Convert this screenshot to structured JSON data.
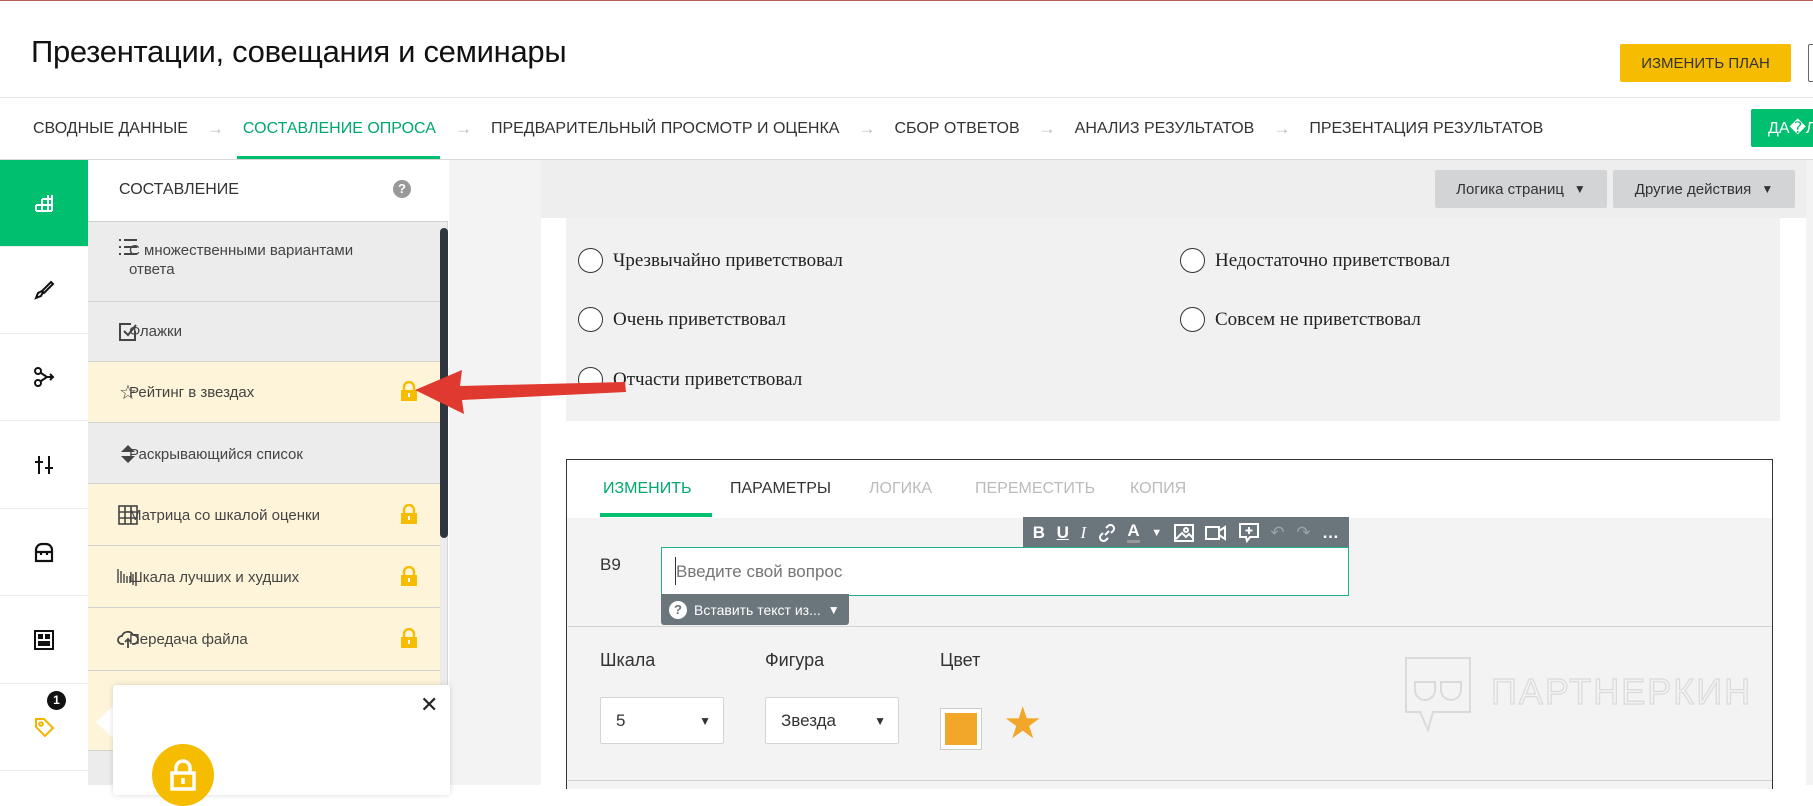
{
  "header": {
    "title": "Презентации, совещания и семинары",
    "change_plan": "ИЗМЕНИТЬ ПЛАН",
    "next": "ДА�ЛЕЕ"
  },
  "breadcrumbs": [
    {
      "label": "СВОДНЫЕ ДАННЫЕ",
      "active": false
    },
    {
      "label": "СОСТАВЛЕНИЕ ОПРОСА",
      "active": true
    },
    {
      "label": "ПРЕДВАРИТЕЛЬНЫЙ ПРОСМОТР И ОЦЕНКА",
      "active": false
    },
    {
      "label": "СБОР ОТВЕТОВ",
      "active": false
    },
    {
      "label": "АНАЛИЗ РЕЗУЛЬТАТОВ",
      "active": false
    },
    {
      "label": "ПРЕЗЕНТАЦИЯ РЕЗУЛЬТАТОВ",
      "active": false
    }
  ],
  "breadcrumb_separator": "→",
  "panel": {
    "title": "СОСТАВЛЕНИЕ",
    "help": "?",
    "items": [
      {
        "label": "С множественными вариантами ответа",
        "icon": "list-icon",
        "locked": false
      },
      {
        "label": "Флажки",
        "icon": "checkbox-icon",
        "locked": false
      },
      {
        "label": "Рейтинг в звездах",
        "icon": "star-icon",
        "locked": true
      },
      {
        "label": "Раскрывающийся список",
        "icon": "dropdown-icon",
        "locked": false
      },
      {
        "label": "Матрица со шкалой оценки",
        "icon": "grid-icon",
        "locked": true
      },
      {
        "label": "Шкала лучших и худших",
        "icon": "scale-icon",
        "locked": true
      },
      {
        "label": "Передача файла",
        "icon": "upload-cloud-icon",
        "locked": true
      }
    ]
  },
  "rail": {
    "badge": "1"
  },
  "toolbar": {
    "page_logic": "Логика страниц",
    "other_actions": "Другие действия"
  },
  "answers": [
    "Чрезвычайно приветствовал",
    "Очень приветствовал",
    "Отчасти приветствовал",
    "Недостаточно приветствовал",
    "Совсем не приветствовал"
  ],
  "editor": {
    "tabs": [
      "ИЗМЕНИТЬ",
      "ПАРАМЕТРЫ",
      "ЛОГИКА",
      "ПЕРЕМЕСТИТЬ",
      "КОПИЯ"
    ],
    "question_number": "В9",
    "question_placeholder": "Введите свой вопрос",
    "insert_text": "Вставить текст из...",
    "scale_label": "Шкала",
    "scale_value": "5",
    "shape_label": "Фигура",
    "shape_value": "Звезда",
    "color_label": "Цвет",
    "color_value": "#f2a62a"
  },
  "watermark": "ПАРТНЕРКИН",
  "colors": {
    "accent": "#00bf6f",
    "plan": "#f6bd00",
    "locked_bg": "#fef4d9",
    "annotation_arrow": "#e0392f"
  }
}
